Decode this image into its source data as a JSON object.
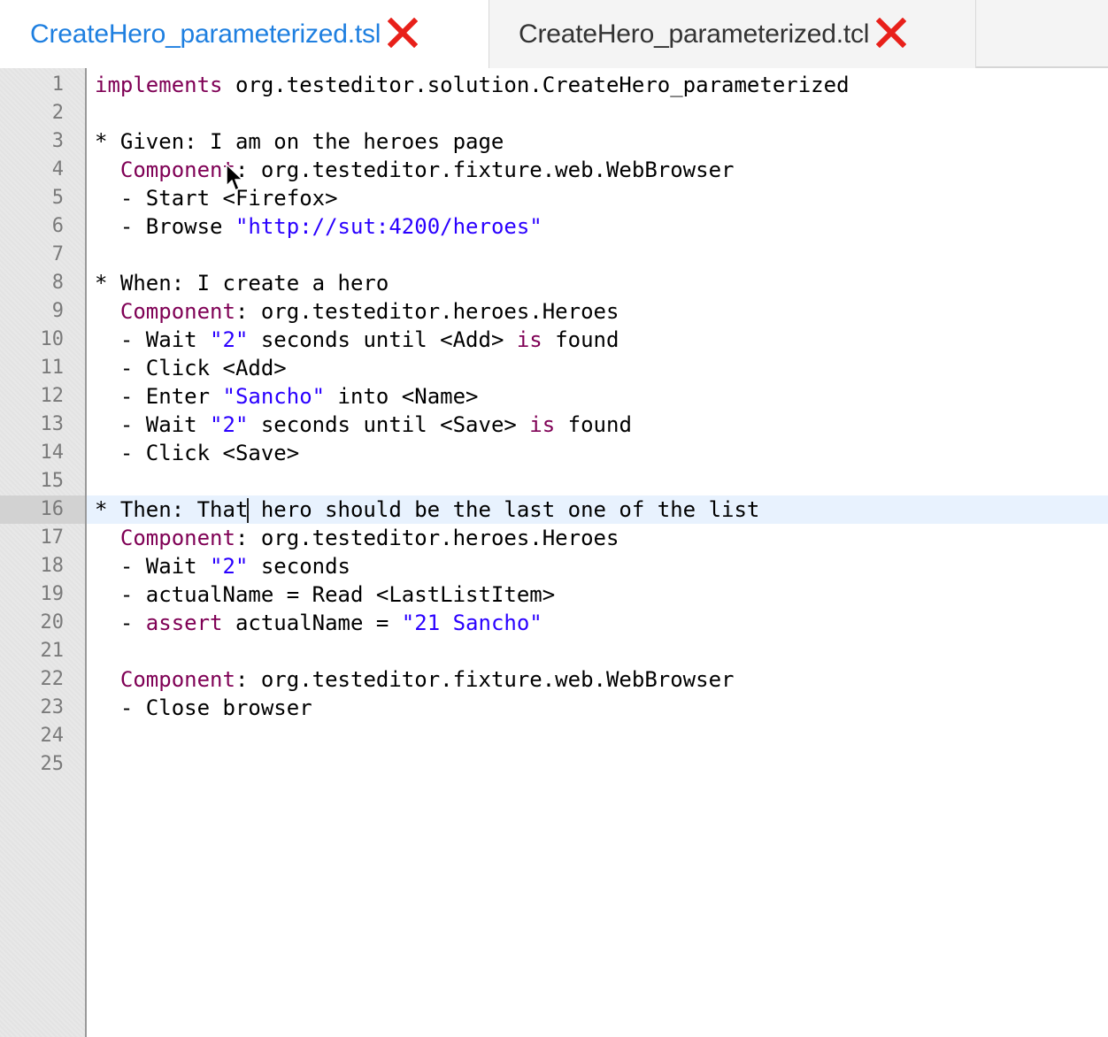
{
  "tabs": [
    {
      "label": "CreateHero_parameterized.tsl",
      "active": true,
      "close_icon": "close-x-icon",
      "close_color": "#e8201a"
    },
    {
      "label": "CreateHero_parameterized.tcl",
      "active": false,
      "close_icon": "close-x-icon",
      "close_color": "#e8201a"
    }
  ],
  "editor": {
    "current_line": 16,
    "lines": [
      {
        "n": "1",
        "segs": [
          {
            "t": "implements",
            "c": "kw"
          },
          {
            "t": " org.testeditor.solution.CreateHero_parameterized",
            "c": ""
          }
        ]
      },
      {
        "n": "2",
        "segs": []
      },
      {
        "n": "3",
        "segs": [
          {
            "t": "* Given: I am on the heroes page",
            "c": ""
          }
        ]
      },
      {
        "n": "4",
        "segs": [
          {
            "t": "  ",
            "c": ""
          },
          {
            "t": "Component",
            "c": "kw"
          },
          {
            "t": ": org.testeditor.fixture.web.WebBrowser",
            "c": ""
          }
        ]
      },
      {
        "n": "5",
        "segs": [
          {
            "t": "  - Start <Firefox>",
            "c": ""
          }
        ]
      },
      {
        "n": "6",
        "segs": [
          {
            "t": "  - Browse ",
            "c": ""
          },
          {
            "t": "\"http://sut:4200/heroes\"",
            "c": "str"
          }
        ]
      },
      {
        "n": "7",
        "segs": []
      },
      {
        "n": "8",
        "segs": [
          {
            "t": "* When: I create a hero",
            "c": ""
          }
        ]
      },
      {
        "n": "9",
        "segs": [
          {
            "t": "  ",
            "c": ""
          },
          {
            "t": "Component",
            "c": "kw"
          },
          {
            "t": ": org.testeditor.heroes.Heroes",
            "c": ""
          }
        ]
      },
      {
        "n": "10",
        "segs": [
          {
            "t": "  - Wait ",
            "c": ""
          },
          {
            "t": "\"2\"",
            "c": "str"
          },
          {
            "t": " seconds until <Add> ",
            "c": ""
          },
          {
            "t": "is",
            "c": "kw"
          },
          {
            "t": " found",
            "c": ""
          }
        ]
      },
      {
        "n": "11",
        "segs": [
          {
            "t": "  - Click <Add>",
            "c": ""
          }
        ]
      },
      {
        "n": "12",
        "segs": [
          {
            "t": "  - Enter ",
            "c": ""
          },
          {
            "t": "\"Sancho\"",
            "c": "str"
          },
          {
            "t": " into <Name>",
            "c": ""
          }
        ]
      },
      {
        "n": "13",
        "segs": [
          {
            "t": "  - Wait ",
            "c": ""
          },
          {
            "t": "\"2\"",
            "c": "str"
          },
          {
            "t": " seconds until <Save> ",
            "c": ""
          },
          {
            "t": "is",
            "c": "kw"
          },
          {
            "t": " found",
            "c": ""
          }
        ]
      },
      {
        "n": "14",
        "segs": [
          {
            "t": "  - Click <Save>",
            "c": ""
          }
        ]
      },
      {
        "n": "15",
        "segs": []
      },
      {
        "n": "16",
        "segs": [
          {
            "t": "* Then: That",
            "c": ""
          },
          {
            "t": "",
            "c": "caret"
          },
          {
            "t": " hero should be the last one of the list",
            "c": ""
          }
        ]
      },
      {
        "n": "17",
        "segs": [
          {
            "t": "  ",
            "c": ""
          },
          {
            "t": "Component",
            "c": "kw"
          },
          {
            "t": ": org.testeditor.heroes.Heroes",
            "c": ""
          }
        ]
      },
      {
        "n": "18",
        "segs": [
          {
            "t": "  - Wait ",
            "c": ""
          },
          {
            "t": "\"2\"",
            "c": "str"
          },
          {
            "t": " seconds",
            "c": ""
          }
        ]
      },
      {
        "n": "19",
        "segs": [
          {
            "t": "  - actualName = Read <LastListItem>",
            "c": ""
          }
        ]
      },
      {
        "n": "20",
        "segs": [
          {
            "t": "  - ",
            "c": ""
          },
          {
            "t": "assert",
            "c": "kw"
          },
          {
            "t": " actualName = ",
            "c": ""
          },
          {
            "t": "\"21 Sancho\"",
            "c": "str"
          }
        ]
      },
      {
        "n": "21",
        "segs": []
      },
      {
        "n": "22",
        "segs": [
          {
            "t": "  ",
            "c": ""
          },
          {
            "t": "Component",
            "c": "kw"
          },
          {
            "t": ": org.testeditor.fixture.web.WebBrowser",
            "c": ""
          }
        ]
      },
      {
        "n": "23",
        "segs": [
          {
            "t": "  - Close browser",
            "c": ""
          }
        ]
      },
      {
        "n": "24",
        "segs": []
      },
      {
        "n": "25",
        "segs": []
      }
    ]
  },
  "colors": {
    "keyword": "#7f0055",
    "string": "#2a00ff",
    "active_tab": "#1e7fe0",
    "current_line": "#e8f2fe"
  },
  "mouse": {
    "icon": "arrow-cursor-icon"
  }
}
